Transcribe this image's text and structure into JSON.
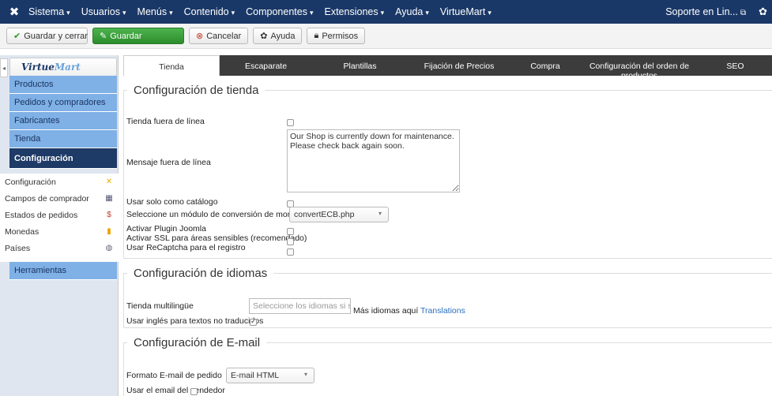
{
  "topnav": {
    "logo": "✖",
    "items": [
      {
        "label": "Sistema",
        "caret": "▾"
      },
      {
        "label": "Usuarios",
        "caret": "▾"
      },
      {
        "label": "Menús",
        "caret": "▾"
      },
      {
        "label": "Contenido",
        "caret": "▾"
      },
      {
        "label": "Componentes",
        "caret": "▾"
      },
      {
        "label": "Extensiones",
        "caret": "▾"
      },
      {
        "label": "Ayuda",
        "caret": "▾"
      },
      {
        "label": "VirtueMart",
        "caret": "▾"
      }
    ],
    "support": "Soporte en Lin...",
    "ext_icon": "⧉",
    "gear_icon": "✿"
  },
  "toolbar": {
    "save_close": "Guardar y cerrar",
    "save": "Guardar",
    "cancel": "Cancelar",
    "help": "Ayuda",
    "permissions": "Permisos"
  },
  "sidebar": {
    "logo_virtue": "Virtue",
    "logo_mart": "Mart",
    "items": [
      "Productos",
      "Pedidos y compradores",
      "Fabricantes",
      "Tienda",
      "Configuración"
    ],
    "sub_items": [
      {
        "label": "Configuración",
        "icon": "✕"
      },
      {
        "label": "Campos de comprador",
        "icon": "▦"
      },
      {
        "label": "Estados de pedidos",
        "icon": "$"
      },
      {
        "label": "Monedas",
        "icon": "▮"
      },
      {
        "label": "Países",
        "icon": "◍"
      }
    ],
    "tools": "Herramientas"
  },
  "tabs": [
    "Tienda",
    "Escaparate",
    "Plantillas",
    "Fijación de Precios",
    "Compra",
    "Configuración del orden de productos",
    "SEO"
  ],
  "shop": {
    "legend": "Configuración de tienda",
    "offline_label": "Tienda fuera de línea",
    "offline_message_label": "Mensaje fuera de línea",
    "offline_message": "Our Shop is currently down for maintenance. Please check back again soon.",
    "catalog_only": "Usar solo como catálogo",
    "currency_module_label": "Seleccione un módulo de conversión de moneda",
    "currency_module_value": "convertECB.php",
    "joomla_plugin": "Activar Plugin Joomla",
    "ssl": "Activar SSL para áreas sensibles (recomendado)",
    "recaptcha": "Usar ReCaptcha para el registro"
  },
  "languages": {
    "legend": "Configuración de idiomas",
    "multilingual_label": "Tienda multilingüe",
    "multilingual_placeholder": "Seleccione los idiomas si su",
    "more_languages": "Más idiomas aquí",
    "translations_link": "Translations",
    "english_fallback": "Usar inglés para textos no traducidos"
  },
  "email": {
    "legend": "Configuración de E-mail",
    "format_label": "Formato E-mail de pedido",
    "format_value": "E-mail HTML",
    "vendor_email": "Usar el email del vendedor"
  }
}
